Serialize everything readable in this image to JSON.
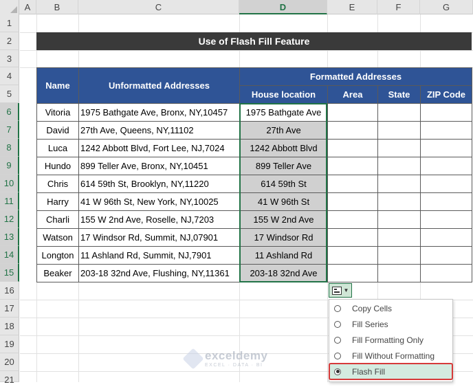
{
  "columns": [
    "A",
    "B",
    "C",
    "D",
    "E",
    "F",
    "G"
  ],
  "rows": [
    "1",
    "2",
    "3",
    "4",
    "5",
    "6",
    "7",
    "8",
    "9",
    "10",
    "11",
    "12",
    "13",
    "14",
    "15",
    "16",
    "17",
    "18",
    "19",
    "20",
    "21"
  ],
  "title": "Use of Flash Fill Feature",
  "table": {
    "header_name": "Name",
    "header_unformatted": "Unformatted Addresses",
    "header_formatted": "Formatted Addresses",
    "subheaders": [
      "House location",
      "Area",
      "State",
      "ZIP Code"
    ],
    "rows": [
      {
        "name": "Vitoria",
        "address": "1975 Bathgate Ave, Bronx, NY,10457",
        "house": "1975 Bathgate Ave"
      },
      {
        "name": "David",
        "address": "27th Ave, Queens, NY,11102",
        "house": "27th Ave"
      },
      {
        "name": "Luca",
        "address": "1242 Abbott Blvd, Fort Lee, NJ,7024",
        "house": "1242 Abbott Blvd"
      },
      {
        "name": "Hundo",
        "address": "899 Teller Ave, Bronx, NY,10451",
        "house": "899 Teller Ave"
      },
      {
        "name": "Chris",
        "address": "614 59th St, Brooklyn, NY,11220",
        "house": "614 59th St"
      },
      {
        "name": "Harry",
        "address": "41 W 96th St, New York, NY,10025",
        "house": "41 W 96th St"
      },
      {
        "name": "Charli",
        "address": "155 W 2nd Ave, Roselle, NJ,7203",
        "house": "155 W 2nd Ave"
      },
      {
        "name": "Watson",
        "address": "17 Windsor Rd, Summit, NJ,07901",
        "house": "17 Windsor Rd"
      },
      {
        "name": "Longton",
        "address": "11 Ashland Rd, Summit, NJ,7901",
        "house": "11 Ashland Rd"
      },
      {
        "name": "Beaker",
        "address": "203-18 32nd Ave, Flushing, NY,11361",
        "house": "203-18 32nd Ave"
      }
    ]
  },
  "autofill_menu": {
    "items": [
      "Copy Cells",
      "Fill Series",
      "Fill Formatting Only",
      "Fill Without Formatting",
      "Flash Fill"
    ],
    "selected": "Flash Fill"
  },
  "watermark": {
    "name": "exceldemy",
    "tagline": "EXCEL · DATA · BI"
  },
  "colors": {
    "header_blue": "#2f5496",
    "title_dark": "#3a3a3a",
    "excel_green": "#217346",
    "highlight_red": "#d63a3a",
    "fill_gray": "#d0d0d0"
  }
}
